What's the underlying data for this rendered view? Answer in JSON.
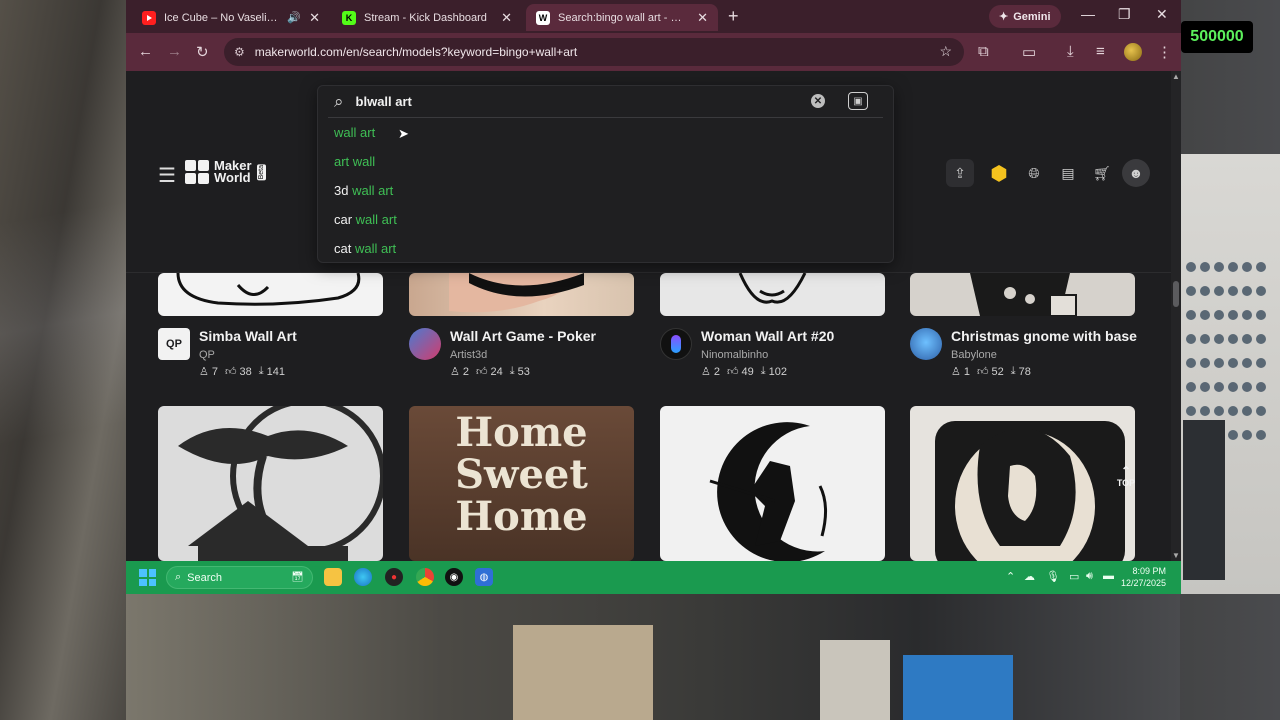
{
  "overlay": {
    "score": "500000"
  },
  "browser": {
    "tabs": [
      {
        "title": "Ice Cube – No Vaseline (Blues Sty",
        "favicon": "youtube-icon"
      },
      {
        "title": "Stream - Kick Dashboard",
        "favicon": "kick-icon"
      },
      {
        "title": "Search:bingo wall art - MakerWorld",
        "favicon": "makerworld-icon",
        "active": true
      }
    ],
    "gemini_label": "Gemini",
    "url": "makerworld.com/en/search/models?keyword=bingo+wall+art"
  },
  "site": {
    "logo_text_1": "Maker",
    "logo_text_2": "World",
    "logo_badge": "Beta",
    "search": {
      "value": "blwall art",
      "suggestions": [
        {
          "prefix": "",
          "match": "wall art"
        },
        {
          "prefix": "",
          "match": "art wall"
        },
        {
          "prefix": "3d ",
          "match": "wall art"
        },
        {
          "prefix": "car ",
          "match": "wall art"
        },
        {
          "prefix": "cat ",
          "match": "wall art"
        }
      ]
    },
    "top_label": "TOP",
    "cards_row1": [
      {
        "title": "Simba Wall Art",
        "author": "QP",
        "avatar": "QP",
        "boosts": "7",
        "likes": "38",
        "downloads": "141"
      },
      {
        "title": "Wall Art Game - Poker",
        "author": "Artist3d",
        "avatar": "",
        "boosts": "2",
        "likes": "24",
        "downloads": "53"
      },
      {
        "title": "Woman Wall Art #20",
        "author": "Ninomalbinho",
        "avatar": "",
        "boosts": "2",
        "likes": "49",
        "downloads": "102"
      },
      {
        "title": "Christmas gnome with base",
        "author": "Babylone",
        "avatar": "",
        "boosts": "1",
        "likes": "52",
        "downloads": "78"
      }
    ],
    "cards_row2_alt": [
      "Bonsai tree wall art",
      "Home Sweet Home sign",
      "Samurai moon wall art",
      "Woman portrait wall art"
    ],
    "row2_text": {
      "home1": "Home",
      "home2": "Sweet",
      "home3": "Home"
    }
  },
  "taskbar": {
    "search_label": "Search",
    "time": "8:09 PM",
    "date": "12/27/2025"
  },
  "colors": {
    "highlight": "#3fbf55",
    "taskbar": "#1a9a4f",
    "browser_frame": "#5a2a3c"
  }
}
